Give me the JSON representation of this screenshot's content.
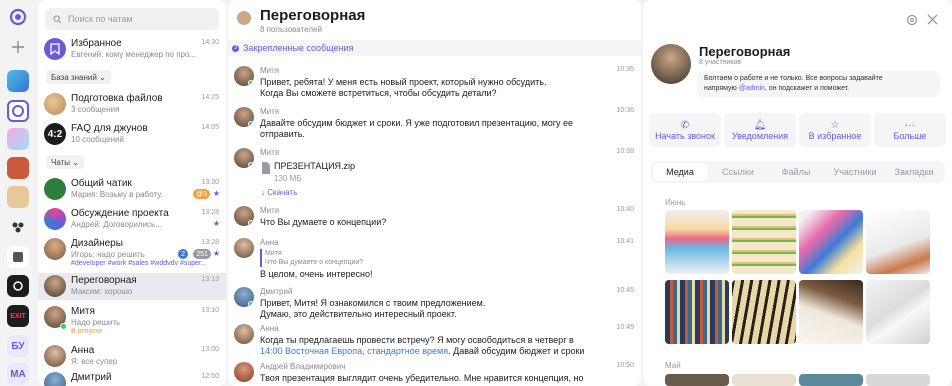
{
  "search": {
    "placeholder": "Поиск по чатам"
  },
  "rail": {
    "user1": "БУ",
    "user2": "МА"
  },
  "chat_list": {
    "favorites": {
      "name": "Избранное",
      "sub": "Евгений: кому менеджер по про...",
      "time": "14:30"
    },
    "group_knowledge": "База знаний",
    "prep": {
      "name": "Подготовка файлов",
      "sub": "3 сообщения",
      "time": "14:25"
    },
    "faq": {
      "name": "FAQ для джунов",
      "sub": "10 сообщений",
      "time": "14:05"
    },
    "group_chats": "Чаты",
    "items": [
      {
        "name": "Общий чатик",
        "sub": "Мария: Возьму в работу.",
        "time": "13:30",
        "badge": "@3"
      },
      {
        "name": "Обсуждение проекта",
        "sub": "Андрей: Договорились...",
        "time": "13:28"
      },
      {
        "name": "Дизайнеры",
        "sub": "Игорь: надо решить",
        "time": "13:28",
        "badge1": "2",
        "badge2": "251",
        "tags": "#developer #work #sales #wddvdv #super..."
      },
      {
        "name": "Переговорная",
        "sub": "Максим: хорошо",
        "time": "13:13"
      },
      {
        "name": "Митя",
        "sub": "Надо решить",
        "time": "13:10",
        "tag": "В отпуске"
      },
      {
        "name": "Анна",
        "sub": "Я: все супер",
        "time": "13:00"
      },
      {
        "name": "Дмитрий",
        "sub": "",
        "time": "12:50"
      }
    ]
  },
  "chat": {
    "title": "Переговорная",
    "sub": "8 пользователей",
    "pinned": "Закрепленные сообщения",
    "messages": [
      {
        "name": "Митя",
        "l1": "Привет, ребята! У меня есть новый проект, который нужно обсудить.",
        "l2": "Когда Вы сможете встретиться, чтобы обсудить детали?",
        "time": "10:35"
      },
      {
        "name": "Митя",
        "l1": "Давайте обсудим бюджет и сроки. Я уже подготовил презентацию, могу ее",
        "l2": "отправить.",
        "time": "10:36"
      },
      {
        "name": "Митя",
        "file": "ПРЕЗЕНТАЦИЯ.zip",
        "size": "130 МБ",
        "download": "Скачать",
        "time": "10:38"
      },
      {
        "name": "Митя",
        "l1": "Что Вы думаете о концепции?",
        "time": "10:40"
      },
      {
        "name": "Анна",
        "quote_name": "Митя",
        "quote": "Что Вы думаете о концепции?",
        "l1": "В целом, очень интересно!",
        "time": "10:41"
      },
      {
        "name": "Дмитрий",
        "l1": "Привет, Митя! Я ознакомился с твоим предложением.",
        "l2": "Думаю, это действительно интересный проект.",
        "time": "10:45"
      },
      {
        "name": "Анна",
        "l1": "Когда ты предлагаешь провести встречу? Я могу освободиться в четверг в",
        "l2_link": "14:00 Восточная Европа, стандартное время",
        "l2_rest": ". Давай обсудим бюджет и сроки",
        "time": "10:49"
      },
      {
        "name": "Андрей Владимирович",
        "l1": "Твоя презентация выглядит очень убедительно. Мне нравится концепция, но",
        "time": "10:50"
      }
    ]
  },
  "info": {
    "title": "Переговорная",
    "sub": "8 участников",
    "desc1": "Болтаем о работе и не только. Все вопросы задавайте",
    "desc2a": "напрямую ",
    "desc2link": "@admin",
    "desc2b": ", он подскажет и поможет.",
    "actions": [
      "Начать звонок",
      "Уведомления",
      "В избранное",
      "Больше"
    ],
    "tabs": [
      "Медиа",
      "Ссылки",
      "Файлы",
      "Участники",
      "Закладки"
    ],
    "month1": "Июнь",
    "month2": "Май"
  },
  "colors": {
    "accent": "#6a5ad8",
    "online": "#2ecc71",
    "link": "#3a7bd5"
  }
}
